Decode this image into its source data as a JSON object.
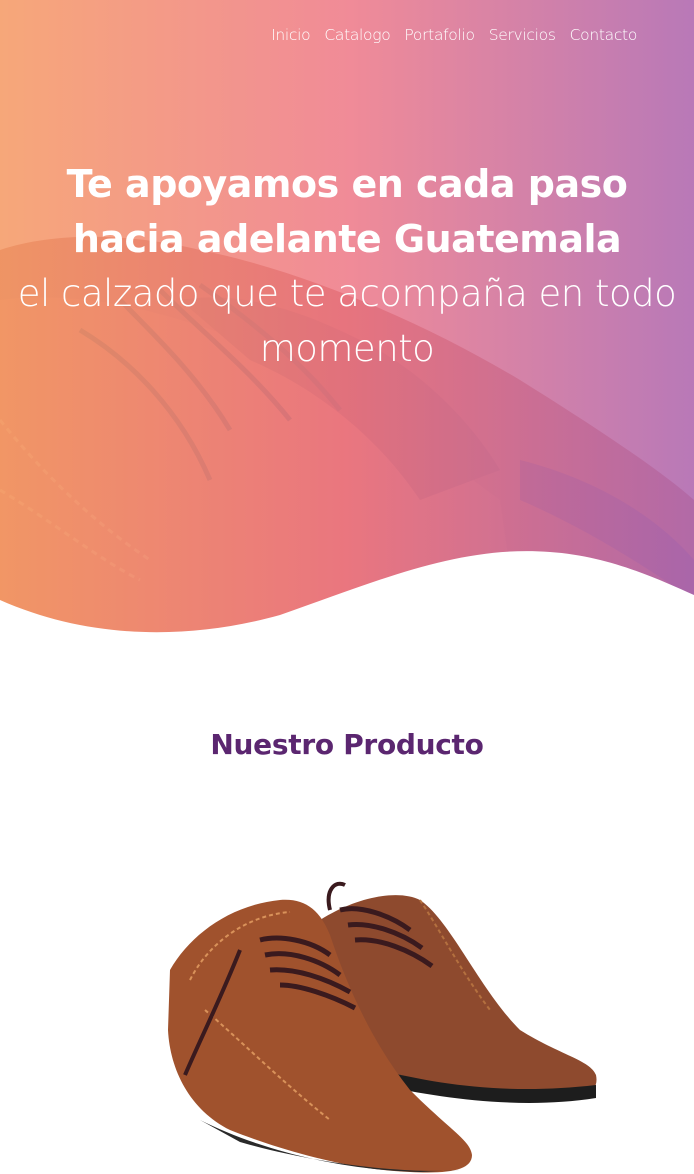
{
  "nav": {
    "items": [
      "Inicio",
      "Catalogo",
      "Portafolio",
      "Servicios",
      "Contacto"
    ]
  },
  "hero": {
    "title": "Te apoyamos en cada paso hacia adelante Guatemala",
    "subtitle": "el calzado que te acompaña en todo momento",
    "gradient_colors": [
      "#f7a06c",
      "#f07d8c",
      "#b26eb4"
    ]
  },
  "product_section": {
    "title": "Nuestro Producto",
    "title_color": "#5b2670"
  }
}
